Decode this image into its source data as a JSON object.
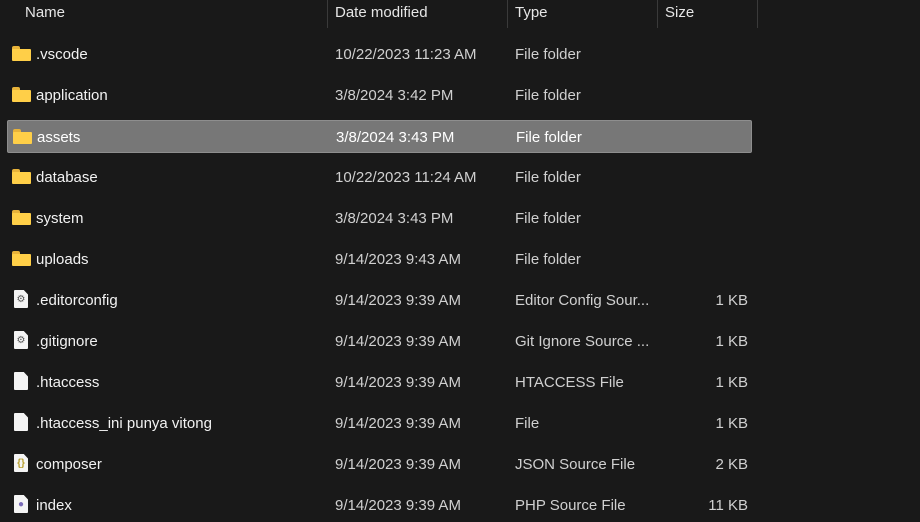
{
  "header": {
    "name": "Name",
    "date_modified": "Date modified",
    "type": "Type",
    "size": "Size"
  },
  "files": [
    {
      "name": ".vscode",
      "date": "10/22/2023 11:23 AM",
      "type": "File folder",
      "size": "",
      "icon": "folder-icon"
    },
    {
      "name": "application",
      "date": "3/8/2024 3:42 PM",
      "type": "File folder",
      "size": "",
      "icon": "folder-icon"
    },
    {
      "name": "assets",
      "date": "3/8/2024 3:43 PM",
      "type": "File folder",
      "size": "",
      "icon": "folder-icon",
      "selected": true
    },
    {
      "name": "database",
      "date": "10/22/2023 11:24 AM",
      "type": "File folder",
      "size": "",
      "icon": "folder-icon"
    },
    {
      "name": "system",
      "date": "3/8/2024 3:43 PM",
      "type": "File folder",
      "size": "",
      "icon": "folder-icon"
    },
    {
      "name": "uploads",
      "date": "9/14/2023 9:43 AM",
      "type": "File folder",
      "size": "",
      "icon": "folder-icon"
    },
    {
      "name": ".editorconfig",
      "date": "9/14/2023 9:39 AM",
      "type": "Editor Config Sour...",
      "size": "1 KB",
      "icon": "config-file-icon"
    },
    {
      "name": ".gitignore",
      "date": "9/14/2023 9:39 AM",
      "type": "Git Ignore Source ...",
      "size": "1 KB",
      "icon": "config-file-icon"
    },
    {
      "name": ".htaccess",
      "date": "9/14/2023 9:39 AM",
      "type": "HTACCESS File",
      "size": "1 KB",
      "icon": "file-icon"
    },
    {
      "name": ".htaccess_ini punya vitong",
      "date": "9/14/2023 9:39 AM",
      "type": "File",
      "size": "1 KB",
      "icon": "file-icon"
    },
    {
      "name": "composer",
      "date": "9/14/2023 9:39 AM",
      "type": "JSON Source File",
      "size": "2 KB",
      "icon": "json-file-icon"
    },
    {
      "name": "index",
      "date": "9/14/2023 9:39 AM",
      "type": "PHP Source File",
      "size": "11 KB",
      "icon": "php-file-icon"
    }
  ],
  "colors": {
    "background": "#191919",
    "selected_row": "#777777",
    "folder": "#ffcf48"
  }
}
